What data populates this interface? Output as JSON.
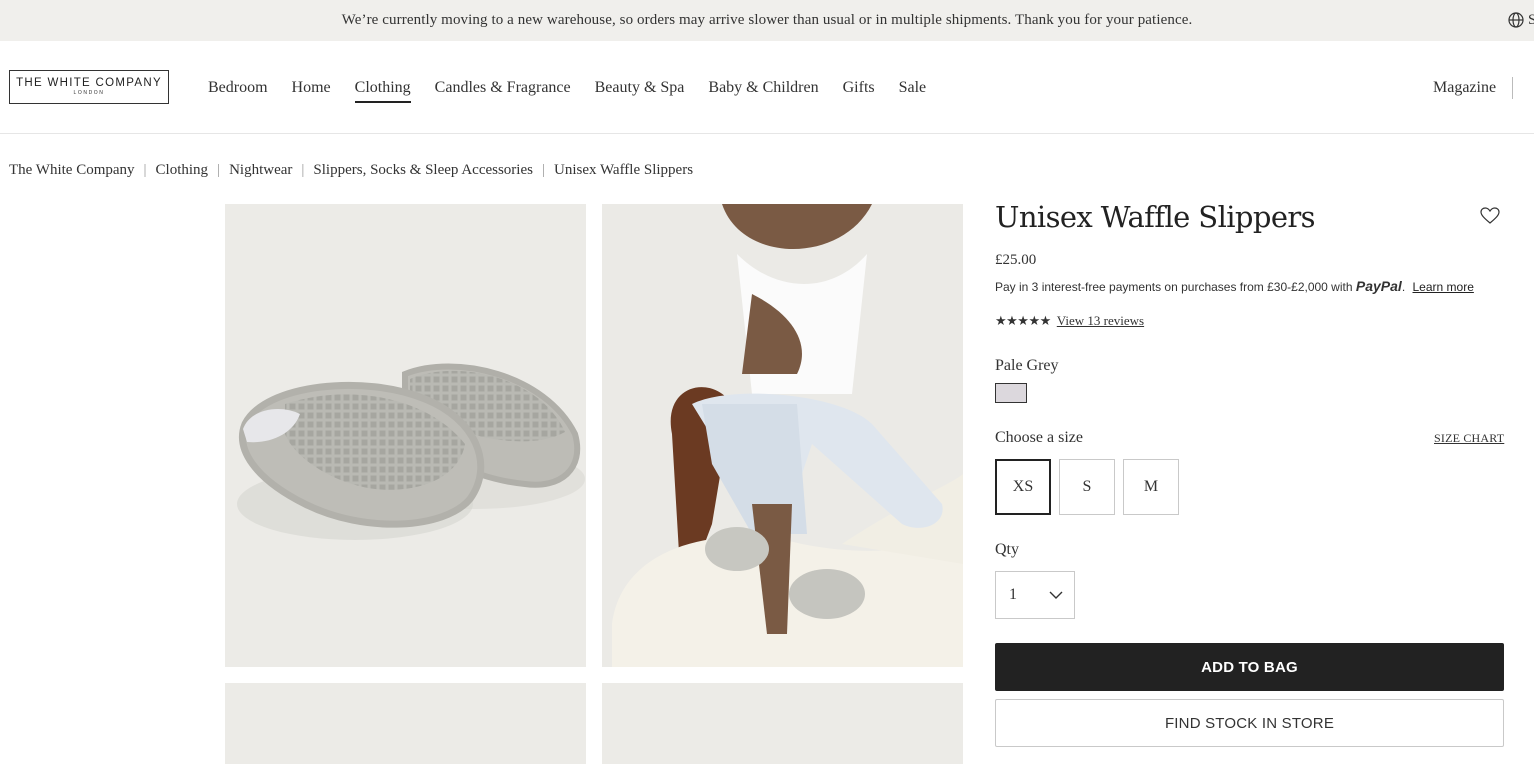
{
  "banner": {
    "message": "We’re currently moving to a new warehouse, so orders may arrive slower than usual or in multiple shipments. Thank you for your patience.",
    "trailing_text": "S"
  },
  "header": {
    "logo_main": "THE WHITE COMPANY",
    "logo_sub": "LONDON",
    "nav": [
      {
        "label": "Bedroom"
      },
      {
        "label": "Home"
      },
      {
        "label": "Clothing",
        "active": true
      },
      {
        "label": "Candles & Fragrance"
      },
      {
        "label": "Beauty & Spa"
      },
      {
        "label": "Baby & Children"
      },
      {
        "label": "Gifts"
      },
      {
        "label": "Sale"
      }
    ],
    "magazine": "Magazine"
  },
  "breadcrumb": {
    "separator": "|",
    "items": [
      "The White Company",
      "Clothing",
      "Nightwear",
      "Slippers, Socks & Sleep Accessories",
      "Unisex Waffle Slippers"
    ]
  },
  "product": {
    "title": "Unisex Waffle Slippers",
    "price": "£25.00",
    "paypal": {
      "text": "Pay in 3 interest-free payments on purchases from £30-£2,000 with",
      "logo": "PayPal",
      "learn_more": "Learn more"
    },
    "rating": {
      "stars": "★★★★★",
      "value": 4.5,
      "out_of": 5,
      "reviews_link": "View 13 reviews"
    },
    "colour": {
      "name": "Pale Grey",
      "swatch_hex": "#dcd8dd"
    },
    "size": {
      "label": "Choose a size",
      "chart_link": "SIZE CHART",
      "options": [
        "XS",
        "S",
        "M"
      ],
      "selected": "XS"
    },
    "qty": {
      "label": "Qty",
      "value": "1"
    },
    "add_to_bag": "ADD TO BAG",
    "find_in_store": "FIND STOCK IN STORE"
  },
  "icons": [
    "globe-icon",
    "heart-icon",
    "chevron-down-icon",
    "star-icon"
  ],
  "colors": {
    "accent": "#222222",
    "banner_bg": "#f0efec",
    "image_bg": "#ecebe7"
  }
}
